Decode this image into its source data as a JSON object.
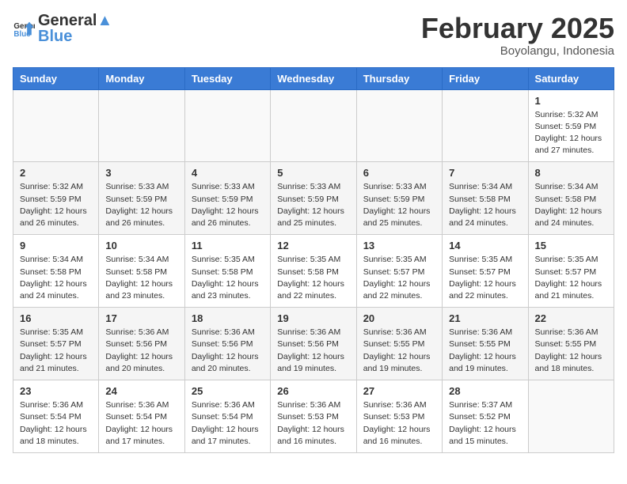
{
  "header": {
    "logo_general": "General",
    "logo_blue": "Blue",
    "month_title": "February 2025",
    "location": "Boyolangu, Indonesia"
  },
  "weekdays": [
    "Sunday",
    "Monday",
    "Tuesday",
    "Wednesday",
    "Thursday",
    "Friday",
    "Saturday"
  ],
  "weeks": [
    [
      {
        "day": "",
        "info": ""
      },
      {
        "day": "",
        "info": ""
      },
      {
        "day": "",
        "info": ""
      },
      {
        "day": "",
        "info": ""
      },
      {
        "day": "",
        "info": ""
      },
      {
        "day": "",
        "info": ""
      },
      {
        "day": "1",
        "info": "Sunrise: 5:32 AM\nSunset: 5:59 PM\nDaylight: 12 hours\nand 27 minutes."
      }
    ],
    [
      {
        "day": "2",
        "info": "Sunrise: 5:32 AM\nSunset: 5:59 PM\nDaylight: 12 hours\nand 26 minutes."
      },
      {
        "day": "3",
        "info": "Sunrise: 5:33 AM\nSunset: 5:59 PM\nDaylight: 12 hours\nand 26 minutes."
      },
      {
        "day": "4",
        "info": "Sunrise: 5:33 AM\nSunset: 5:59 PM\nDaylight: 12 hours\nand 26 minutes."
      },
      {
        "day": "5",
        "info": "Sunrise: 5:33 AM\nSunset: 5:59 PM\nDaylight: 12 hours\nand 25 minutes."
      },
      {
        "day": "6",
        "info": "Sunrise: 5:33 AM\nSunset: 5:59 PM\nDaylight: 12 hours\nand 25 minutes."
      },
      {
        "day": "7",
        "info": "Sunrise: 5:34 AM\nSunset: 5:58 PM\nDaylight: 12 hours\nand 24 minutes."
      },
      {
        "day": "8",
        "info": "Sunrise: 5:34 AM\nSunset: 5:58 PM\nDaylight: 12 hours\nand 24 minutes."
      }
    ],
    [
      {
        "day": "9",
        "info": "Sunrise: 5:34 AM\nSunset: 5:58 PM\nDaylight: 12 hours\nand 24 minutes."
      },
      {
        "day": "10",
        "info": "Sunrise: 5:34 AM\nSunset: 5:58 PM\nDaylight: 12 hours\nand 23 minutes."
      },
      {
        "day": "11",
        "info": "Sunrise: 5:35 AM\nSunset: 5:58 PM\nDaylight: 12 hours\nand 23 minutes."
      },
      {
        "day": "12",
        "info": "Sunrise: 5:35 AM\nSunset: 5:58 PM\nDaylight: 12 hours\nand 22 minutes."
      },
      {
        "day": "13",
        "info": "Sunrise: 5:35 AM\nSunset: 5:57 PM\nDaylight: 12 hours\nand 22 minutes."
      },
      {
        "day": "14",
        "info": "Sunrise: 5:35 AM\nSunset: 5:57 PM\nDaylight: 12 hours\nand 22 minutes."
      },
      {
        "day": "15",
        "info": "Sunrise: 5:35 AM\nSunset: 5:57 PM\nDaylight: 12 hours\nand 21 minutes."
      }
    ],
    [
      {
        "day": "16",
        "info": "Sunrise: 5:35 AM\nSunset: 5:57 PM\nDaylight: 12 hours\nand 21 minutes."
      },
      {
        "day": "17",
        "info": "Sunrise: 5:36 AM\nSunset: 5:56 PM\nDaylight: 12 hours\nand 20 minutes."
      },
      {
        "day": "18",
        "info": "Sunrise: 5:36 AM\nSunset: 5:56 PM\nDaylight: 12 hours\nand 20 minutes."
      },
      {
        "day": "19",
        "info": "Sunrise: 5:36 AM\nSunset: 5:56 PM\nDaylight: 12 hours\nand 19 minutes."
      },
      {
        "day": "20",
        "info": "Sunrise: 5:36 AM\nSunset: 5:55 PM\nDaylight: 12 hours\nand 19 minutes."
      },
      {
        "day": "21",
        "info": "Sunrise: 5:36 AM\nSunset: 5:55 PM\nDaylight: 12 hours\nand 19 minutes."
      },
      {
        "day": "22",
        "info": "Sunrise: 5:36 AM\nSunset: 5:55 PM\nDaylight: 12 hours\nand 18 minutes."
      }
    ],
    [
      {
        "day": "23",
        "info": "Sunrise: 5:36 AM\nSunset: 5:54 PM\nDaylight: 12 hours\nand 18 minutes."
      },
      {
        "day": "24",
        "info": "Sunrise: 5:36 AM\nSunset: 5:54 PM\nDaylight: 12 hours\nand 17 minutes."
      },
      {
        "day": "25",
        "info": "Sunrise: 5:36 AM\nSunset: 5:54 PM\nDaylight: 12 hours\nand 17 minutes."
      },
      {
        "day": "26",
        "info": "Sunrise: 5:36 AM\nSunset: 5:53 PM\nDaylight: 12 hours\nand 16 minutes."
      },
      {
        "day": "27",
        "info": "Sunrise: 5:36 AM\nSunset: 5:53 PM\nDaylight: 12 hours\nand 16 minutes."
      },
      {
        "day": "28",
        "info": "Sunrise: 5:37 AM\nSunset: 5:52 PM\nDaylight: 12 hours\nand 15 minutes."
      },
      {
        "day": "",
        "info": ""
      }
    ]
  ]
}
